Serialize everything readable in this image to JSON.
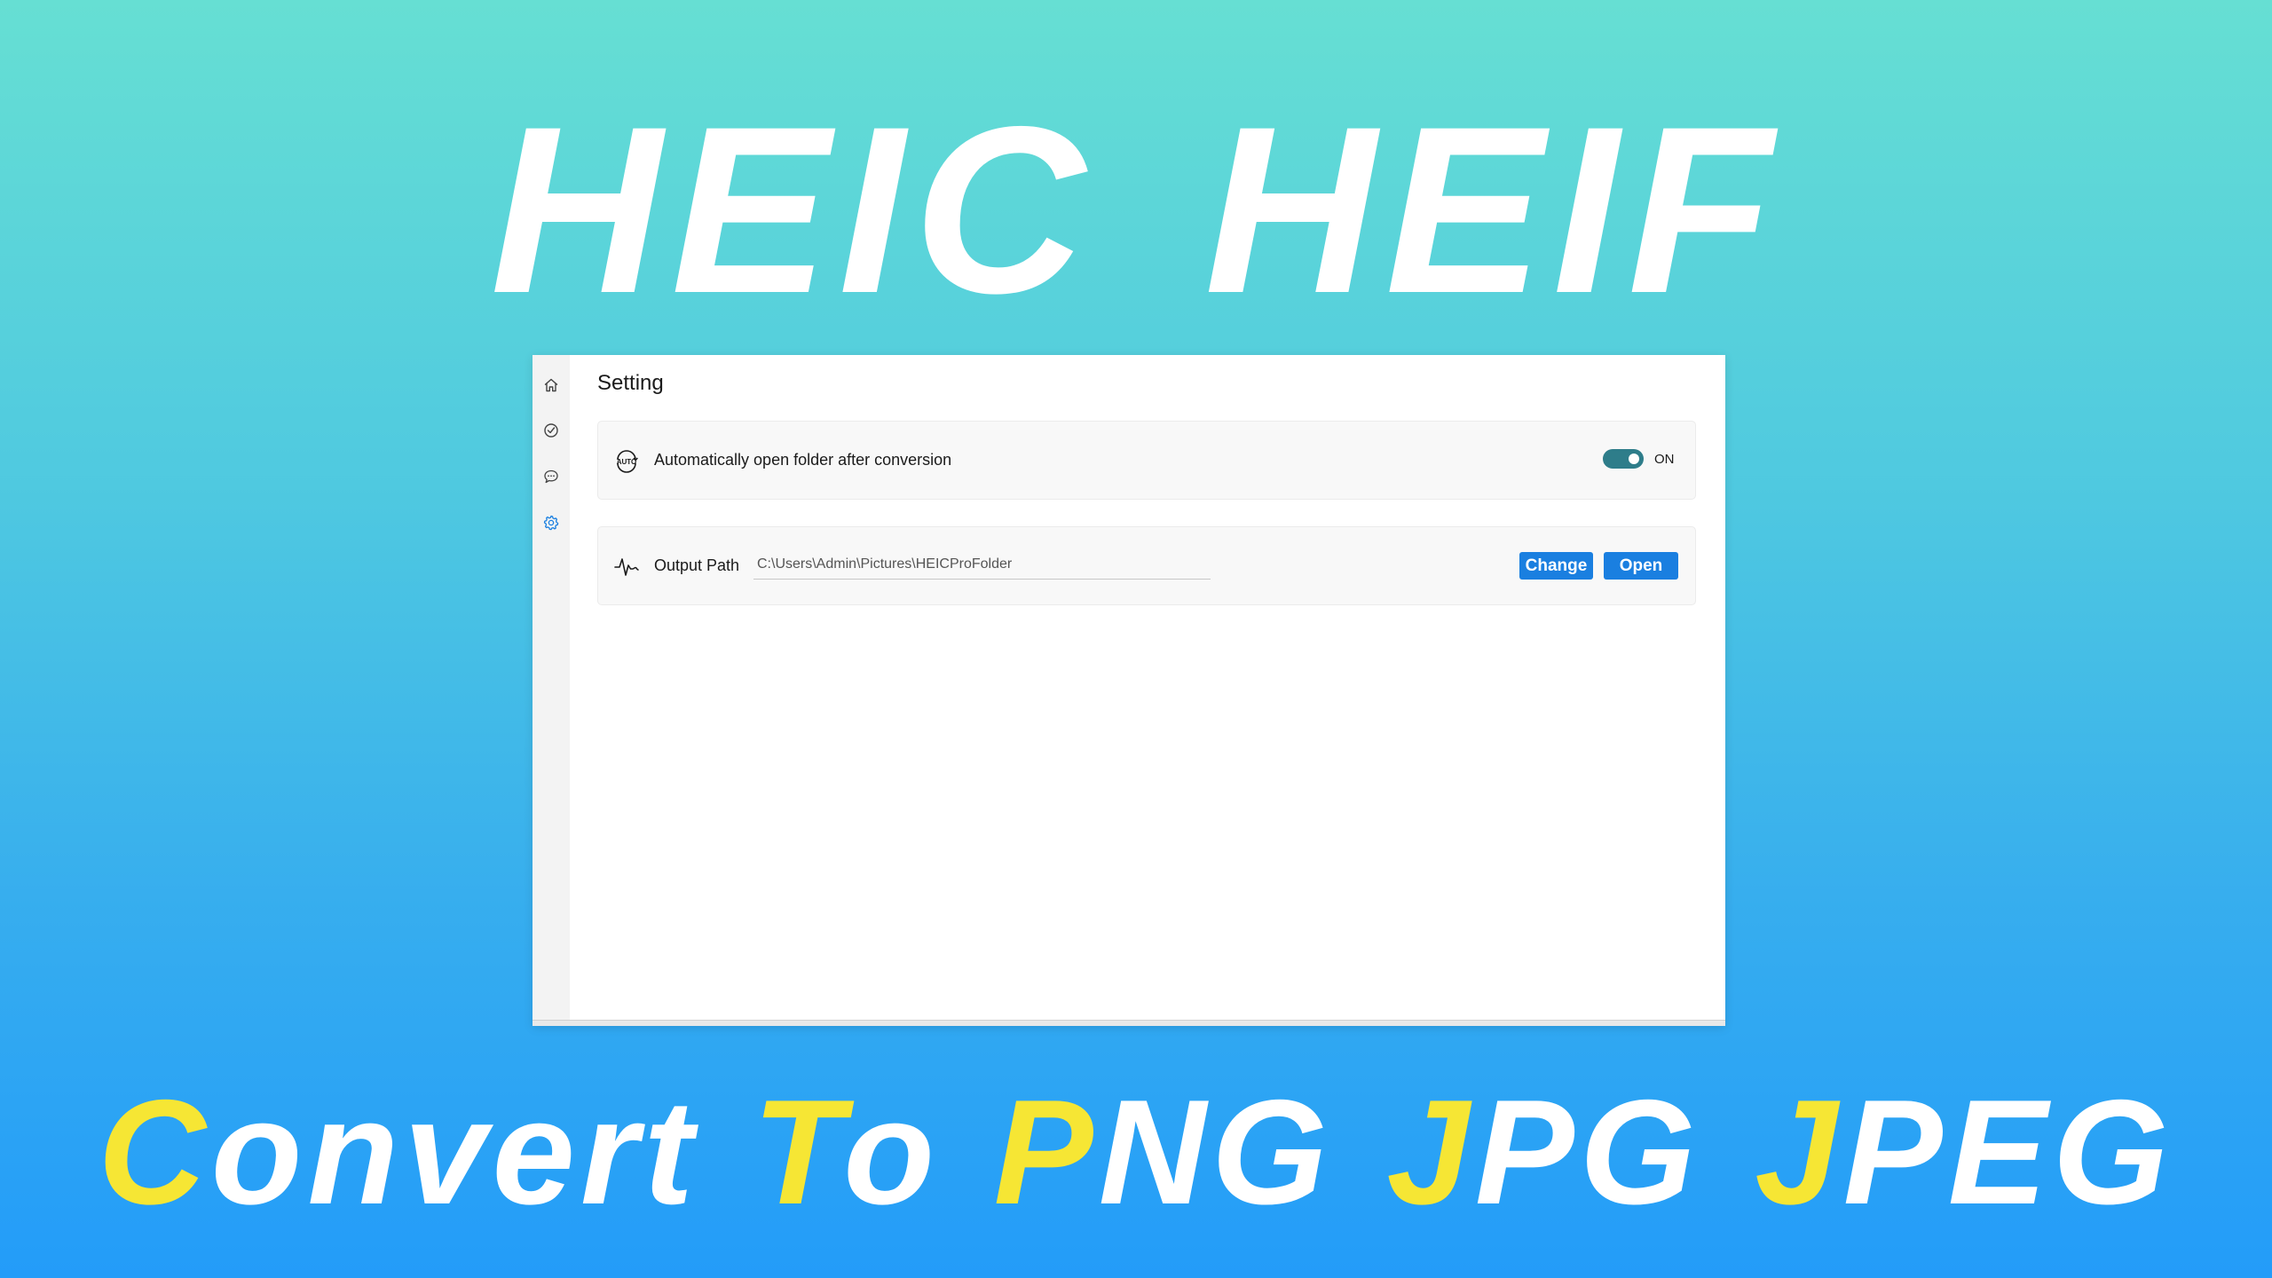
{
  "banner": {
    "headline_top": "HEIC HEIF",
    "headline_bottom": [
      {
        "accent": "C",
        "rest": "onvert"
      },
      {
        "accent": "T",
        "rest": "o"
      },
      {
        "accent": "P",
        "rest": "NG"
      },
      {
        "accent": "J",
        "rest": "PG"
      },
      {
        "accent": "J",
        "rest": "PEG"
      }
    ],
    "accent_color": "#f6e634",
    "text_color": "#ffffff"
  },
  "app": {
    "sidebar": {
      "items": [
        {
          "icon": "home-icon",
          "active": false
        },
        {
          "icon": "convert-icon",
          "active": false
        },
        {
          "icon": "feedback-icon",
          "active": false
        },
        {
          "icon": "settings-icon",
          "active": true
        }
      ],
      "active_color": "#1a7fe0"
    },
    "page_title": "Setting",
    "auto_open": {
      "icon": "auto-icon",
      "icon_text": "AUTO",
      "label": "Automatically open folder after conversion",
      "toggle_on": true,
      "state_label": "ON"
    },
    "output_path": {
      "icon": "pulse-icon",
      "label": "Output Path",
      "value": "C:\\Users\\Admin\\Pictures\\HEICProFolder",
      "change_label": "Change",
      "open_label": "Open"
    },
    "button_color": "#1a7fe0",
    "toggle_color": "#2e7d8a"
  }
}
